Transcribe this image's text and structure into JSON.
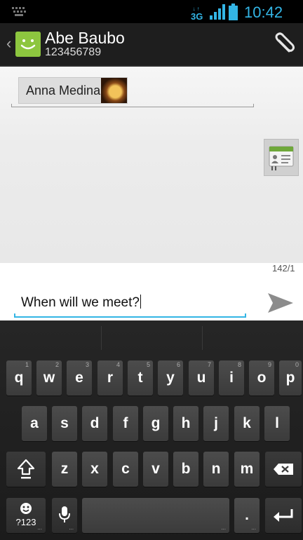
{
  "status_bar": {
    "network": "3G",
    "time": "10:42 AM"
  },
  "header": {
    "contact_name": "Abe Baubo",
    "phone_number": "123456789"
  },
  "recipients": {
    "chip_label": "Anna Medina"
  },
  "compose": {
    "counter": "142/1",
    "message": "When will we meet?"
  },
  "keyboard": {
    "row1": [
      {
        "label": "q",
        "hint": "1"
      },
      {
        "label": "w",
        "hint": "2"
      },
      {
        "label": "e",
        "hint": "3"
      },
      {
        "label": "r",
        "hint": "4"
      },
      {
        "label": "t",
        "hint": "5"
      },
      {
        "label": "y",
        "hint": "6"
      },
      {
        "label": "u",
        "hint": "7"
      },
      {
        "label": "i",
        "hint": "8"
      },
      {
        "label": "o",
        "hint": "9"
      },
      {
        "label": "p",
        "hint": "0"
      }
    ],
    "row2": [
      "a",
      "s",
      "d",
      "f",
      "g",
      "h",
      "j",
      "k",
      "l"
    ],
    "row3": [
      "z",
      "x",
      "c",
      "v",
      "b",
      "n",
      "m"
    ],
    "symbols_label": "?123",
    "period_label": "."
  },
  "icons": {
    "back": "chevron-left-icon",
    "avatar": "messaging-avatar-icon",
    "attach": "paperclip-icon",
    "contacts": "contacts-book-icon",
    "send": "send-icon",
    "shift": "shift-icon",
    "backspace": "backspace-icon",
    "emoji": "emoji-icon",
    "mic": "microphone-icon",
    "enter": "enter-icon"
  },
  "colors": {
    "accent": "#33b5e5",
    "avatar_green": "#8dc63f",
    "header_bg": "#1e1e1e"
  }
}
